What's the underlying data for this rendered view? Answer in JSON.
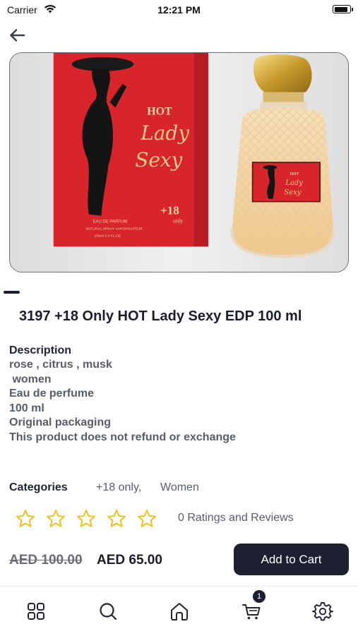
{
  "status_bar": {
    "carrier": "Carrier",
    "time": "12:21 PM"
  },
  "product": {
    "title": "3197 +18 Only HOT Lady Sexy EDP 100 ml",
    "image": {
      "box_brand": "HOT",
      "box_name_line1": "Lady",
      "box_name_line2": "Sexy",
      "box_age": "+18",
      "box_age_sub": "only",
      "box_fine_print1": "EAU DE PARFUM",
      "box_fine_print2": "NATURAL SPRAY VAPORISATEUR",
      "box_fine_print3": "100ml 3.4 FL.OZ",
      "bottle_label_brand": "HOT",
      "bottle_label_name": "Lady",
      "bottle_label_name2": "Sexy"
    },
    "description": {
      "heading": "Description",
      "lines": [
        "rose , citrus , musk",
        " women",
        "Eau de perfume",
        "100 ml",
        "Original packaging",
        "This product does not refund or exchange"
      ]
    },
    "categories": {
      "label": "Categories",
      "items": [
        "+18 only,",
        "Women"
      ]
    },
    "rating": {
      "stars_filled": 0,
      "stars_total": 5,
      "text": "0 Ratings and Reviews"
    },
    "price": {
      "old": "AED 100.00",
      "new": "AED 65.00"
    },
    "add_to_cart_label": "Add to Cart"
  },
  "tabbar": {
    "items": [
      "apps-grid-icon",
      "search-icon",
      "home-icon",
      "cart-icon",
      "settings-gear-icon"
    ],
    "cart_badge": "1"
  },
  "colors": {
    "primary_dark": "#1c2030",
    "star": "#f2c21b",
    "box_red": "#d8242b"
  }
}
